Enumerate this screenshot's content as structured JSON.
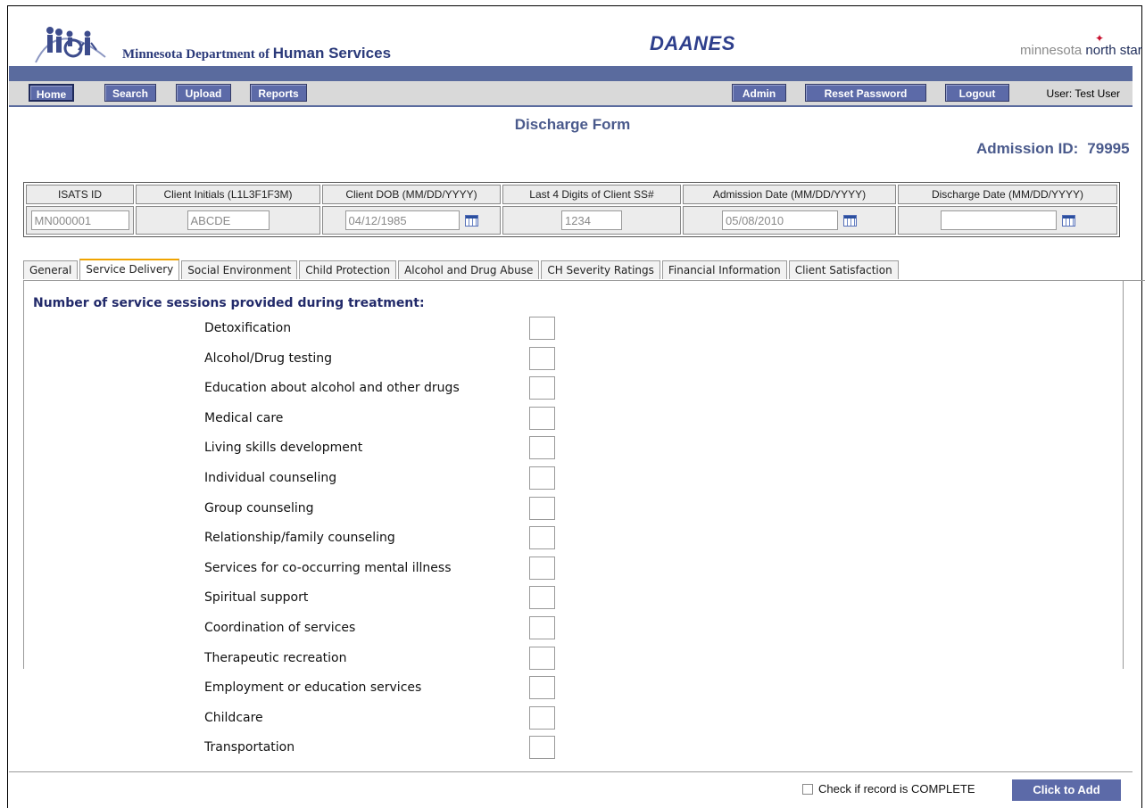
{
  "header": {
    "dept_prefix": "Minnesota Department of",
    "dept_name": "Human Services",
    "app_name": "DAANES",
    "northstar_prefix": "minnesota",
    "northstar_name": "north star"
  },
  "nav": {
    "home": "Home",
    "search": "Search",
    "upload": "Upload",
    "reports": "Reports",
    "admin": "Admin",
    "reset_password": "Reset Password",
    "logout": "Logout",
    "user_label": "User: Test User"
  },
  "form": {
    "title": "Discharge Form",
    "admission_label": "Admission ID:",
    "admission_id": "79995"
  },
  "id_table": {
    "headers": [
      "ISATS ID",
      "Client Initials (L1L3F1F3M)",
      "Client DOB (MM/DD/YYYY)",
      "Last 4 Digits of Client SS#",
      "Admission Date (MM/DD/YYYY)",
      "Discharge Date (MM/DD/YYYY)"
    ],
    "values": [
      "MN000001",
      "ABCDE",
      "04/12/1985",
      "1234",
      "05/08/2010",
      ""
    ]
  },
  "tabs": [
    "General",
    "Service Delivery",
    "Social Environment",
    "Child Protection",
    "Alcohol and Drug Abuse",
    "CH Severity Ratings",
    "Financial Information",
    "Client Satisfaction"
  ],
  "active_tab": "Service Delivery",
  "section": {
    "heading": "Number of service sessions provided during treatment:",
    "services": [
      "Detoxification",
      "Alcohol/Drug testing",
      "Education about alcohol and other drugs",
      "Medical care",
      "Living skills development",
      "Individual counseling",
      "Group counseling",
      "Relationship/family counseling",
      "Services for co-occurring mental illness",
      "Spiritual support",
      "Coordination of services",
      "Therapeutic recreation",
      "Employment or education services",
      "Childcare",
      "Transportation"
    ]
  },
  "footer": {
    "complete_label": "Check if record is COMPLETE",
    "add_button": "Click to Add"
  },
  "colors": {
    "nav_button": "#5c6aa8",
    "header_bar": "#5a6b9e",
    "title_text": "#4a5a8c",
    "active_tab_accent": "#f0a400"
  }
}
